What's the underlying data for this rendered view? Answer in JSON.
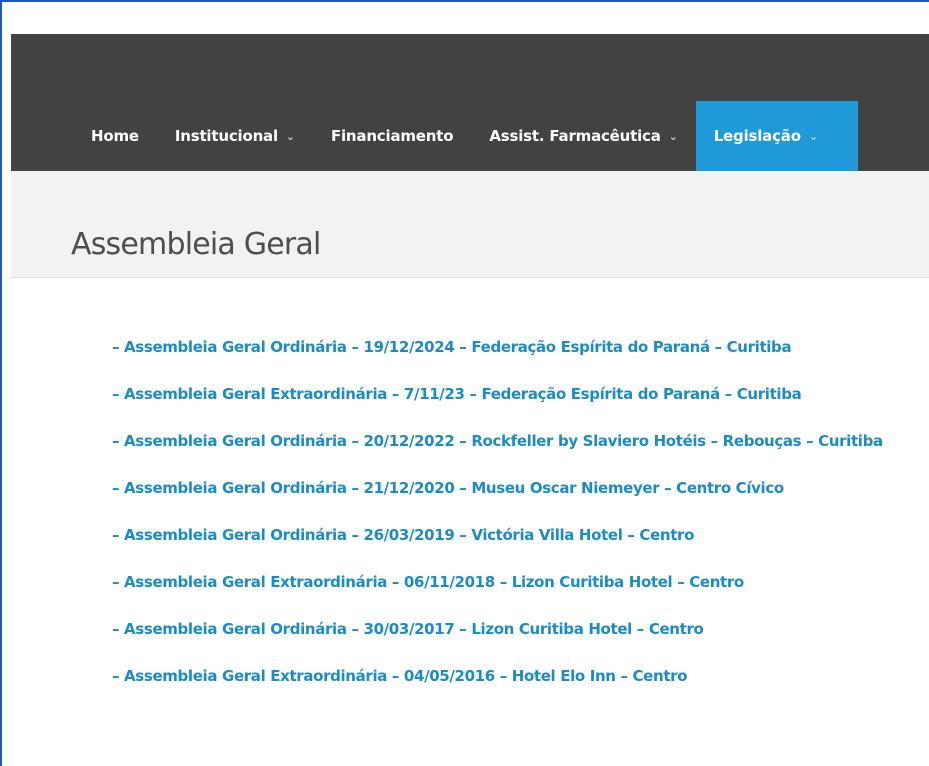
{
  "nav": {
    "items": [
      {
        "label": "Home",
        "has_dropdown": false
      },
      {
        "label": "Institucional",
        "has_dropdown": true
      },
      {
        "label": "Financiamento",
        "has_dropdown": false
      },
      {
        "label": "Assist. Farmacêutica",
        "has_dropdown": true
      },
      {
        "label": "Legislação",
        "has_dropdown": true,
        "active": true
      }
    ],
    "chevron": "⌄"
  },
  "page": {
    "title": "Assembleia Geral"
  },
  "links": [
    "– Assembleia Geral Ordinária – 19/12/2024 – Federação Espírita do Paraná – Curitiba",
    "– Assembleia Geral Extraordinária – 7/11/23 – Federação Espírita do Paraná – Curitiba",
    "– Assembleia Geral Ordinária – 20/12/2022 – Rockfeller by Slaviero Hotéis – Rebouças – Curitiba",
    "– Assembleia Geral Ordinária – 21/12/2020 – Museu Oscar Niemeyer – Centro Cívico",
    "– Assembleia Geral Ordinária – 26/03/2019 – Victória Villa Hotel – Centro",
    "– Assembleia Geral Extraordinária – 06/11/2018 – Lizon Curitiba Hotel – Centro",
    "– Assembleia Geral Ordinária – 30/03/2017 – Lizon Curitiba Hotel – Centro",
    "– Assembleia Geral Extraordinária – 04/05/2016 – Hotel Elo Inn – Centro"
  ],
  "colors": {
    "nav_bg": "#424242",
    "nav_active": "#1e9ad8",
    "title_bar_bg": "#f2f2f2",
    "link": "#1b8cc5",
    "frame_border": "#1f57c8"
  }
}
